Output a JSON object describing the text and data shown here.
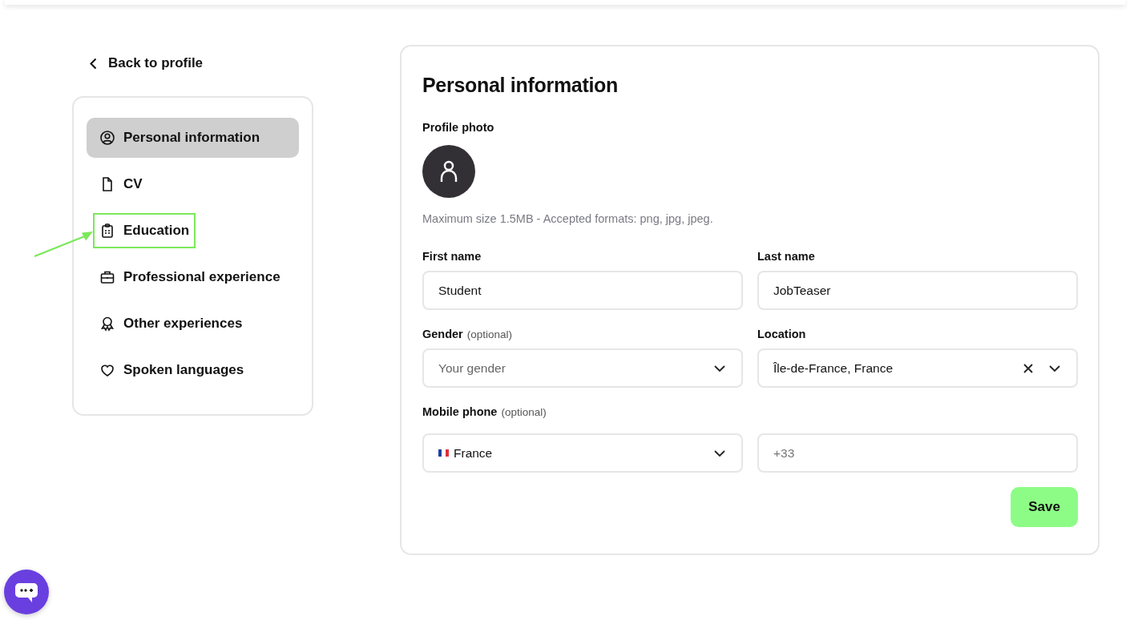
{
  "back_link": {
    "label": "Back to profile"
  },
  "nav": [
    {
      "label": "Personal information",
      "kind": "person",
      "selected": true,
      "highlighted": false
    },
    {
      "label": "CV",
      "kind": "file",
      "selected": false,
      "highlighted": false
    },
    {
      "label": "Education",
      "kind": "clipboard",
      "selected": false,
      "highlighted": true
    },
    {
      "label": "Professional experience",
      "kind": "briefcase",
      "selected": false,
      "highlighted": false
    },
    {
      "label": "Other experiences",
      "kind": "award",
      "selected": false,
      "highlighted": false
    },
    {
      "label": "Spoken languages",
      "kind": "heart",
      "selected": false,
      "highlighted": false
    }
  ],
  "form": {
    "title": "Personal information",
    "photo": {
      "label": "Profile photo",
      "hint": "Maximum size 1.5MB - Accepted formats: png, jpg, jpeg."
    },
    "rows": [
      {
        "fields": [
          {
            "kind": "text",
            "label": "First name",
            "value": "Student"
          },
          {
            "kind": "text",
            "label": "Last name",
            "value": "JobTeaser"
          }
        ]
      },
      {
        "fields": [
          {
            "kind": "select",
            "label": "Gender",
            "optional": "(optional)",
            "placeholder": "Your gender"
          },
          {
            "kind": "select",
            "label": "Location",
            "value": "Île-de-France, France",
            "clearable": true
          }
        ]
      },
      {
        "fields": [
          {
            "kind": "country",
            "label": "Mobile phone",
            "optional": "(optional)",
            "value": "France"
          },
          {
            "kind": "text",
            "placeholder": "+33"
          }
        ]
      }
    ],
    "save_button": "Save"
  }
}
